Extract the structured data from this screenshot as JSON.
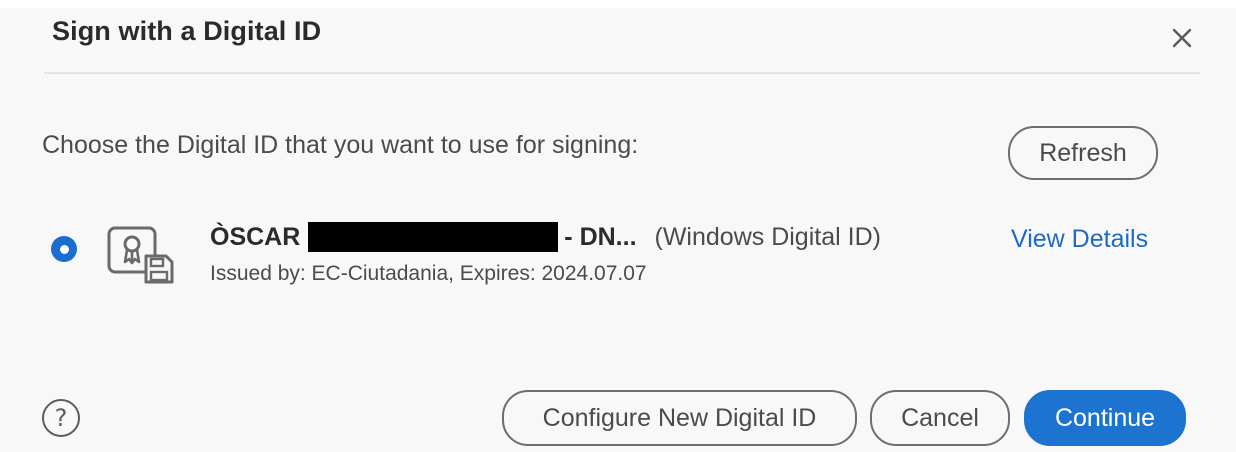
{
  "dialog": {
    "title": "Sign with a Digital ID",
    "close_icon": "close-icon",
    "prompt": "Choose the Digital ID that you want to use for signing:",
    "refresh_label": "Refresh"
  },
  "digital_id": {
    "selected": true,
    "name": "ÒSCAR",
    "suffix": "- DN...",
    "type": "(Windows Digital ID)",
    "issuer": "Issued by: EC-Ciutadania, Expires: 2024.07.07",
    "view_details_label": "View Details",
    "icon": "certificate-icon"
  },
  "footer": {
    "help_symbol": "?",
    "configure_label": "Configure New Digital ID",
    "cancel_label": "Cancel",
    "continue_label": "Continue"
  },
  "colors": {
    "accent": "#1d73d0",
    "link": "#1d6ac4",
    "background": "#f8f8f8"
  }
}
